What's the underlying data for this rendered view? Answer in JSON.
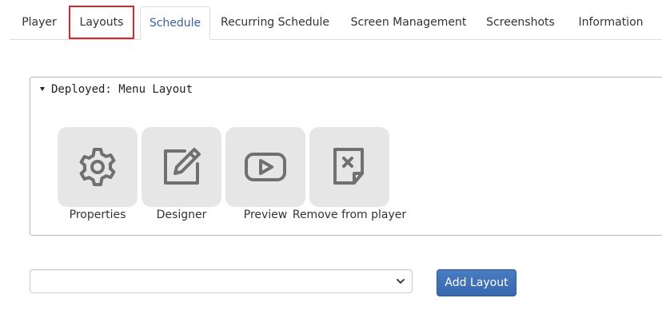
{
  "tabs": [
    {
      "label": "Player"
    },
    {
      "label": "Layouts"
    },
    {
      "label": "Schedule"
    },
    {
      "label": "Recurring Schedule"
    },
    {
      "label": "Screen Management"
    },
    {
      "label": "Screenshots"
    },
    {
      "label": "Information"
    }
  ],
  "active_tab": "Schedule",
  "highlighted_tab": "Layouts",
  "deployed_panel": {
    "title": "Deployed: Menu Layout",
    "actions": [
      {
        "label": "Properties",
        "icon": "gear-icon"
      },
      {
        "label": "Designer",
        "icon": "edit-icon"
      },
      {
        "label": "Preview",
        "icon": "play-icon"
      },
      {
        "label": "Remove from player",
        "icon": "remove-file-icon"
      }
    ]
  },
  "layout_select": {
    "value": ""
  },
  "add_layout_button": {
    "label": "Add Layout"
  },
  "colors": {
    "active_tab_text": "#3a5f9c",
    "highlight_border": "#e0232a",
    "button_bg": "#3e6fb5",
    "icon_tile_bg": "#e6e6e6",
    "icon_stroke": "#707070"
  }
}
